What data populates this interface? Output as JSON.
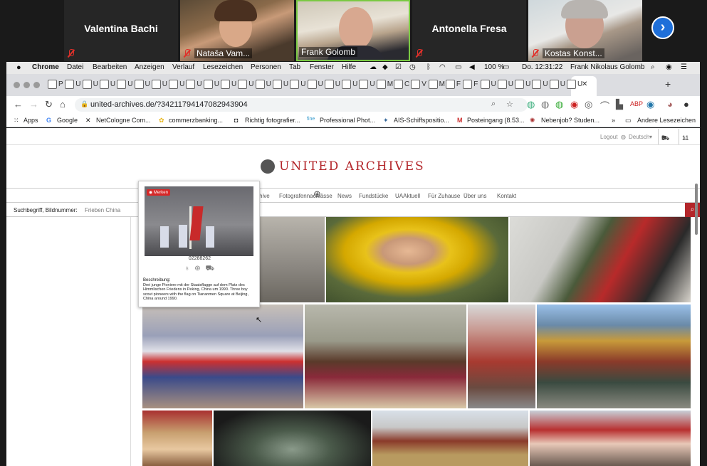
{
  "zoom": {
    "participants": [
      {
        "name": "Valentina Bachi",
        "video": false
      },
      {
        "name": "Nataša Vam...",
        "video": true
      },
      {
        "name": "Frank Golomb",
        "video": true
      },
      {
        "name": "Antonella Fresa",
        "video": false
      },
      {
        "name": "Kostas Konst...",
        "video": true
      }
    ]
  },
  "menubar": {
    "items": [
      "Chrome",
      "Datei",
      "Bearbeiten",
      "Anzeigen",
      "Verlauf",
      "Lesezeichen",
      "Personen",
      "Tab",
      "Fenster",
      "Hilfe"
    ],
    "battery": "100 %",
    "clock": "Do. 12:31:22",
    "user": "Frank Nikolaus Golomb"
  },
  "browser": {
    "tab_letters": [
      "P",
      "U",
      "U",
      "U",
      "U",
      "U",
      "U",
      "U",
      "U",
      "U",
      "U",
      "U",
      "U",
      "U",
      "U",
      "U",
      "U",
      "U",
      "U",
      "M",
      "C",
      "V",
      "M",
      "F",
      "F",
      "U",
      "U",
      "U",
      "U",
      "U",
      "U"
    ],
    "url": "united-archives.de/?34211794147082943904",
    "bookmarks": [
      "Apps",
      "Google",
      "NetCologne Com...",
      "commerzbanking...",
      "Richtig fotografier...",
      "Professional Phot...",
      "AIS-Schiffspositio...",
      "Posteingang (8.53...",
      "Nebenjob? Studen...",
      "»",
      "Andere Lesezeichen"
    ]
  },
  "site": {
    "logout": "Logout",
    "language": "Deutsch",
    "cart_count": "5",
    "lightbox_count": "11",
    "logo": "UNITED ARCHIVES",
    "nav": [
      "Archive",
      "Fotografennachlässe",
      "News",
      "Fundstücke",
      "UAAktuell",
      "Für Zuhause",
      "Über uns",
      "Kontakt"
    ],
    "search_label": "Suchbegriff, Bildnummer:",
    "search_value": "Frieben China"
  },
  "popup": {
    "badge": "Merken",
    "image_id": "02288262",
    "desc_head": "Beschreibung:",
    "description": "Drei junge Pioniere mit der Staatsflagge auf dem Platz des Himmlischen Friedens in Peking, China um 1990. Three boy scout pioneers with the flag on Tiananmen Square at Beijing, China around 1990."
  }
}
